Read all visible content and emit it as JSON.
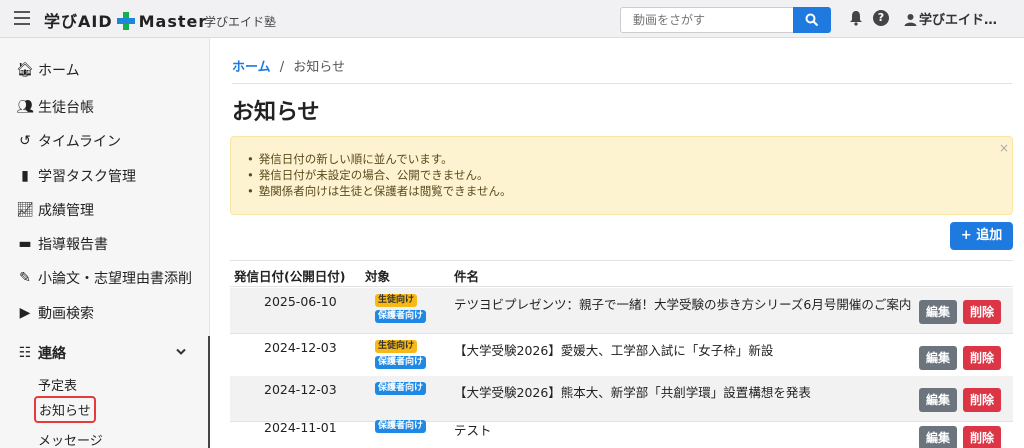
{
  "header": {
    "brand_pre": "学びAID",
    "brand_post": "Master",
    "school": "学びエイド塾",
    "search_placeholder": "動画をさがす",
    "user": "学びエイド…"
  },
  "sidebar": {
    "items": [
      {
        "icon": "home-icon",
        "glyph": "🏠︎",
        "label": "ホーム"
      },
      {
        "icon": "users-icon",
        "glyph": "👥︎",
        "label": "生徒台帳"
      },
      {
        "icon": "history-icon",
        "glyph": "↺",
        "label": "タイムライン"
      },
      {
        "icon": "book-icon",
        "glyph": "▮",
        "label": "学習タスク管理"
      },
      {
        "icon": "chart-icon",
        "glyph": "📈︎",
        "label": "成績管理"
      },
      {
        "icon": "file-icon",
        "glyph": "▬",
        "label": "指導報告書"
      },
      {
        "icon": "pen-icon",
        "glyph": "✎",
        "label": "小論文・志望理由書添削"
      },
      {
        "icon": "video-icon",
        "glyph": "▶",
        "label": "動画検索"
      }
    ],
    "group": {
      "icon": "contact-icon",
      "glyph": "☷",
      "label": "連絡"
    },
    "sub_items": [
      "予定表",
      "お知らせ",
      "メッセージ"
    ]
  },
  "main": {
    "breadcrumb_home": "ホーム",
    "breadcrumb_sep": "/",
    "breadcrumb_current": "お知らせ",
    "title": "お知らせ",
    "alert": [
      "発信日付の新しい順に並んでいます。",
      "発信日付が未設定の場合、公開できません。",
      "塾関係者向けは生徒と保護者は閲覧できません。"
    ],
    "alert_close": "×",
    "add_label": "+ 追加",
    "columns": [
      "発信日付(公開日付)",
      "対象",
      "件名"
    ],
    "edit_label": "編集",
    "delete_label": "削除",
    "rows": [
      {
        "date": "2025-06-10",
        "b1": "生徒向け",
        "b2": "保護者向け",
        "subject": "テツヨビプレゼンツ：親子で一緒！大学受験の歩き方シリーズ6月号開催のご案内"
      },
      {
        "date": "2024-12-03",
        "b1": "生徒向け",
        "b2": "保護者向け",
        "subject": "【大学受験2026】愛媛大、工学部入試に「女子枠」新設"
      },
      {
        "date": "2024-12-03",
        "b1": "",
        "b2": "保護者向け",
        "subject": "【大学受験2026】熊本大、新学部「共創学環」設置構想を発表"
      },
      {
        "date": "2024-11-01",
        "b1": "",
        "b2": "保護者向け",
        "subject": "テスト"
      }
    ]
  }
}
